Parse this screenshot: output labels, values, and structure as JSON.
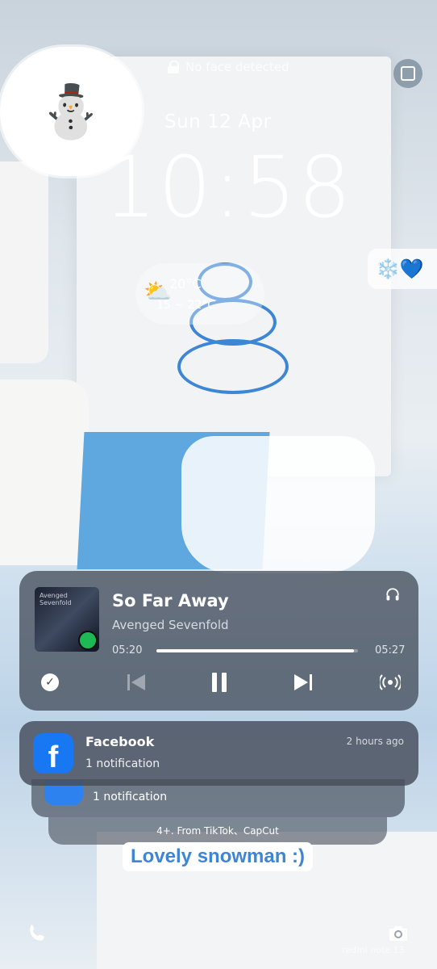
{
  "lockscreen": {
    "status_text": "No face detected",
    "date": "Sun 12 Apr",
    "time": "10:58"
  },
  "weather": {
    "current": "20°C",
    "range": "15 ~ 22°C"
  },
  "media": {
    "album_art_text": "Avenged Sevenfold",
    "song": "So Far Away",
    "artist": "Avenged Sevenfold",
    "elapsed": "05:20",
    "duration": "05:27",
    "progress": 0.978
  },
  "notifications": {
    "main": {
      "app": "Facebook",
      "time": "2 hours ago",
      "text": "1 notification"
    },
    "second": {
      "text": "1 notification"
    },
    "more": {
      "text": "4+. From TikTok、CapCut"
    }
  },
  "wallpaper": {
    "caption": "Lovely snowman :)",
    "emoji_pill": "❄️💙",
    "sticker_emoji": "⛄"
  },
  "watermark": "redmi note 13",
  "colors": {
    "card": "#3c4250",
    "spotify": "#1db954",
    "facebook": "#1877f2",
    "accent_blue": "#3f85d6"
  }
}
